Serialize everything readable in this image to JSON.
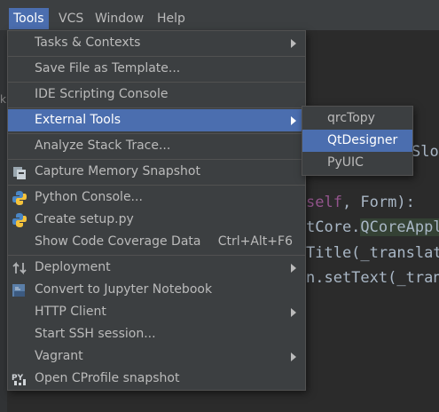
{
  "menubar": {
    "items": [
      {
        "label": "Tools",
        "mnemonic": "T",
        "active": true
      },
      {
        "label": "VCS",
        "mnemonic": "S",
        "active": false
      },
      {
        "label": "Window",
        "mnemonic": "W",
        "active": false
      },
      {
        "label": "Help",
        "mnemonic": "H",
        "active": false
      }
    ]
  },
  "tools_menu": {
    "items": [
      {
        "label": "Tasks & Contexts",
        "has_submenu": true
      },
      {
        "label": "Save File as Template..."
      },
      {
        "label": "IDE Scripting Console"
      },
      {
        "label": "External Tools",
        "has_submenu": true,
        "active": true
      },
      {
        "label": "Analyze Stack Trace..."
      },
      {
        "label": "Capture Memory Snapshot",
        "icon": "memory-snapshot-icon"
      },
      {
        "label": "Python Console...",
        "icon": "python-icon"
      },
      {
        "label": "Create setup.py",
        "icon": "python-icon"
      },
      {
        "label": "Show Code Coverage Data",
        "shortcut": "Ctrl+Alt+F6"
      },
      {
        "label": "Deployment",
        "has_submenu": true,
        "icon": "deployment-icon"
      },
      {
        "label": "Convert to Jupyter Notebook",
        "icon": "jupyter-icon"
      },
      {
        "label": "HTTP Client",
        "has_submenu": true
      },
      {
        "label": "Start SSH session..."
      },
      {
        "label": "Vagrant",
        "has_submenu": true
      },
      {
        "label": "Open CProfile snapshot",
        "icon": "py-profile-icon"
      }
    ]
  },
  "external_tools_submenu": {
    "items": [
      {
        "label": "qrcTopy"
      },
      {
        "label": "QtDesigner",
        "active": true
      },
      {
        "label": "PyUIC"
      }
    ]
  },
  "editor": {
    "line1": "Slo",
    "line2_a": "self",
    "line2_b": ", Form):",
    "line3_a": "tCore.",
    "line3_b": "QCoreAppl",
    "line4_a": "Title(",
    "line4_b": "_translat",
    "line5_a": "n.setText(",
    "line5_b": "_tran",
    "gutter_fragment": "k"
  },
  "colors": {
    "menu_bg": "#3c3f41",
    "highlight": "#4b6eaf",
    "editor_bg": "#2b2b2b",
    "text": "#bbbbbb"
  }
}
